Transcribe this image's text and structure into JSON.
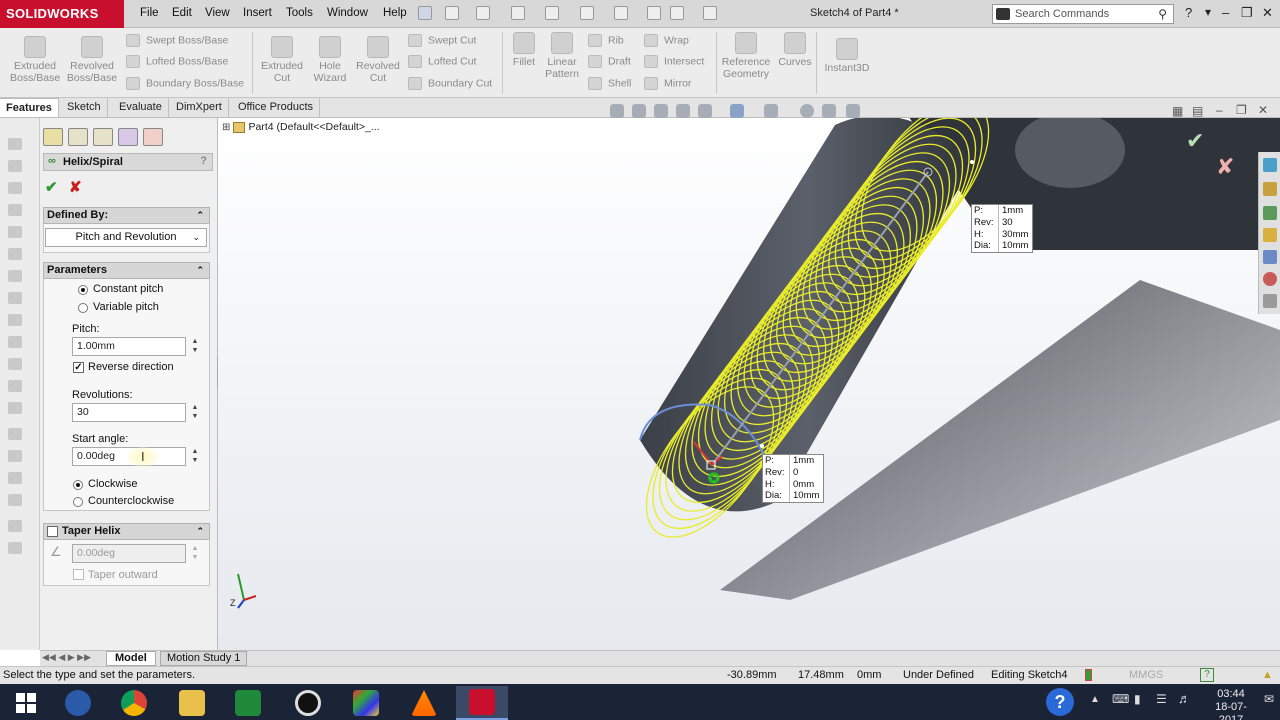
{
  "app": {
    "name": "SOLIDWORKS",
    "document_title": "Sketch4 of Part4 *"
  },
  "menu": [
    "File",
    "Edit",
    "View",
    "Insert",
    "Tools",
    "Window",
    "Help"
  ],
  "search": {
    "placeholder": "Search Commands"
  },
  "command_manager": {
    "big_buttons": [
      {
        "label": "Extruded\nBoss/Base",
        "icon": "extrude-boss-icon"
      },
      {
        "label": "Revolved\nBoss/Base",
        "icon": "revolve-boss-icon"
      },
      {
        "label": "Extruded\nCut",
        "icon": "extrude-cut-icon"
      },
      {
        "label": "Hole\nWizard",
        "icon": "hole-wizard-icon"
      },
      {
        "label": "Revolved\nCut",
        "icon": "revolve-cut-icon"
      },
      {
        "label": "Fillet",
        "icon": "fillet-icon"
      },
      {
        "label": "Linear\nPattern",
        "icon": "linear-pattern-icon"
      },
      {
        "label": "Reference\nGeometry",
        "icon": "reference-geometry-icon"
      },
      {
        "label": "Curves",
        "icon": "curves-icon"
      },
      {
        "label": "Instant3D",
        "icon": "instant3d-icon"
      }
    ],
    "small_buttons": {
      "swept_boss": "Swept Boss/Base",
      "lofted_boss": "Lofted Boss/Base",
      "boundary_boss": "Boundary Boss/Base",
      "swept_cut": "Swept Cut",
      "lofted_cut": "Lofted Cut",
      "boundary_cut": "Boundary Cut",
      "rib": "Rib",
      "draft": "Draft",
      "shell": "Shell",
      "wrap": "Wrap",
      "intersect": "Intersect",
      "mirror": "Mirror"
    }
  },
  "tabs": [
    "Features",
    "Sketch",
    "Evaluate",
    "DimXpert",
    "Office Products"
  ],
  "active_tab": "Features",
  "property_manager": {
    "title": "Helix/Spiral",
    "defined_by": {
      "header": "Defined By:",
      "value": "Pitch and Revolution"
    },
    "parameters": {
      "header": "Parameters",
      "constant_pitch": "Constant pitch",
      "variable_pitch": "Variable pitch",
      "pitch_label": "Pitch:",
      "pitch_value": "1.00mm",
      "reverse_direction": "Reverse direction",
      "revolutions_label": "Revolutions:",
      "revolutions_value": "30",
      "start_angle_label": "Start angle:",
      "start_angle_value": "0.00deg",
      "clockwise": "Clockwise",
      "counterclockwise": "Counterclockwise",
      "selected_pitch_mode": "Constant pitch",
      "selected_direction": "Clockwise",
      "reverse_checked": true
    },
    "taper": {
      "header": "Taper Helix",
      "angle_value": "0.00deg",
      "taper_outward": "Taper outward"
    }
  },
  "feature_tree": {
    "item": "Part4  (Default<<Default>_..."
  },
  "callouts": {
    "end": [
      {
        "k": "P:",
        "v": "1mm"
      },
      {
        "k": "Rev:",
        "v": "30"
      },
      {
        "k": "H:",
        "v": "30mm"
      },
      {
        "k": "Dia:",
        "v": "10mm"
      }
    ],
    "start": [
      {
        "k": "P:",
        "v": "1mm"
      },
      {
        "k": "Rev:",
        "v": "0"
      },
      {
        "k": "H:",
        "v": "0mm"
      },
      {
        "k": "Dia:",
        "v": "10mm"
      }
    ]
  },
  "triad": {
    "z": "Z"
  },
  "bottom_tabs": [
    "Model",
    "Motion Study 1"
  ],
  "status": {
    "message": "Select the type and set the parameters.",
    "x": "-30.89mm",
    "y": "17.48mm",
    "z": "0mm",
    "state": "Under Defined",
    "editing": "Editing Sketch4",
    "units": "MMGS"
  },
  "taskbar": {
    "time": "03:44",
    "date": "18-07-2017"
  },
  "colors": {
    "brand": "#c8102e",
    "helix": "#e8ec2a",
    "cylinder": "#4a4e57",
    "accent": "#4f6fb0"
  }
}
